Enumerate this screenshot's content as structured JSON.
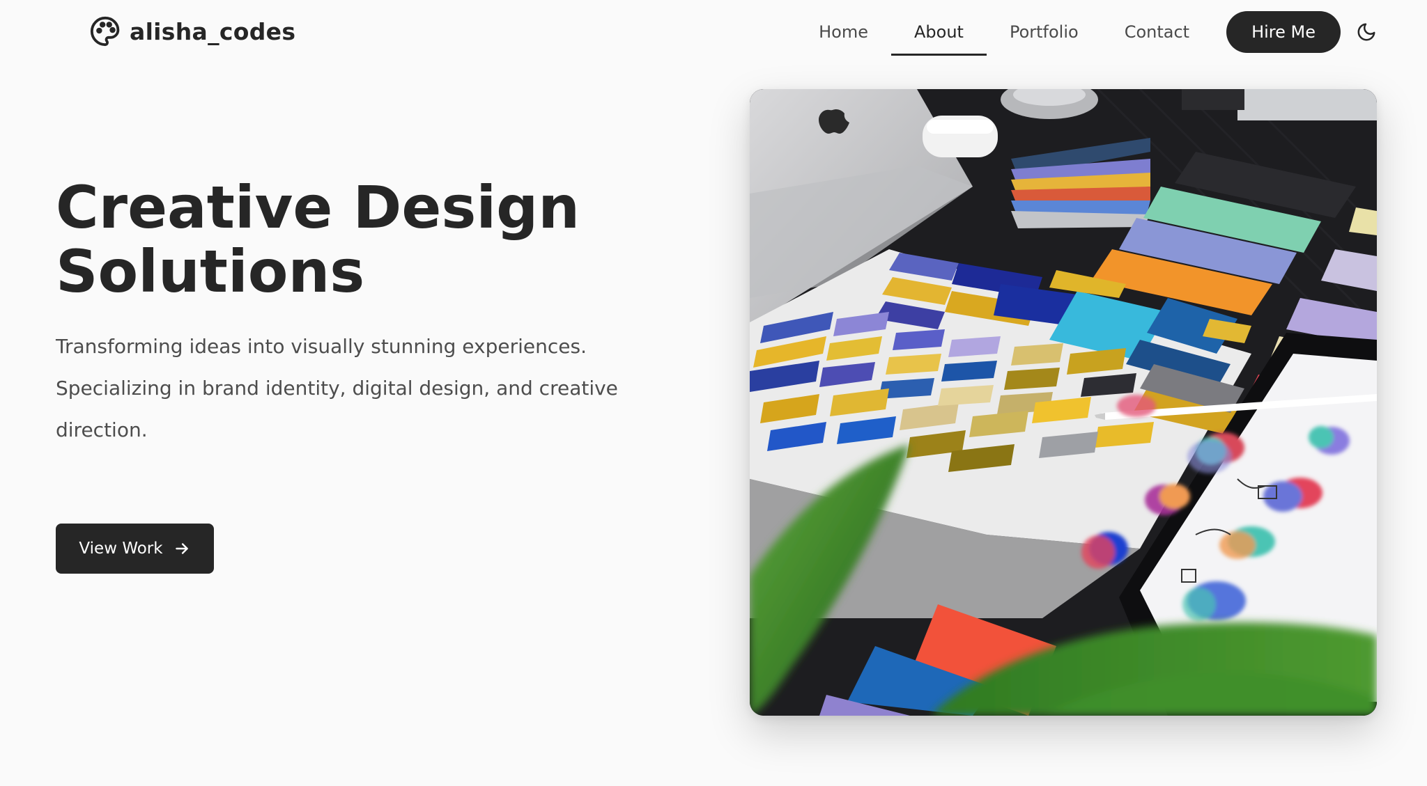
{
  "brand": {
    "name": "alisha_codes",
    "icon": "palette-icon"
  },
  "nav": {
    "items": [
      {
        "label": "Home",
        "active": false
      },
      {
        "label": "About",
        "active": true
      },
      {
        "label": "Portfolio",
        "active": false
      },
      {
        "label": "Contact",
        "active": false
      }
    ],
    "cta_label": "Hire Me",
    "theme_icon": "moon-icon"
  },
  "hero": {
    "title_line1": "Creative Design",
    "title_line2": "Solutions",
    "description": "Transforming ideas into visually stunning experiences. Specializing in brand identity, digital design, and creative direction.",
    "button_label": "View Work",
    "button_icon": "arrow-right-icon",
    "image_subject": "design-workspace-photo"
  },
  "colors": {
    "background": "#fafafa",
    "text": "#262626",
    "muted": "#4d4d4d",
    "button": "#262626"
  }
}
